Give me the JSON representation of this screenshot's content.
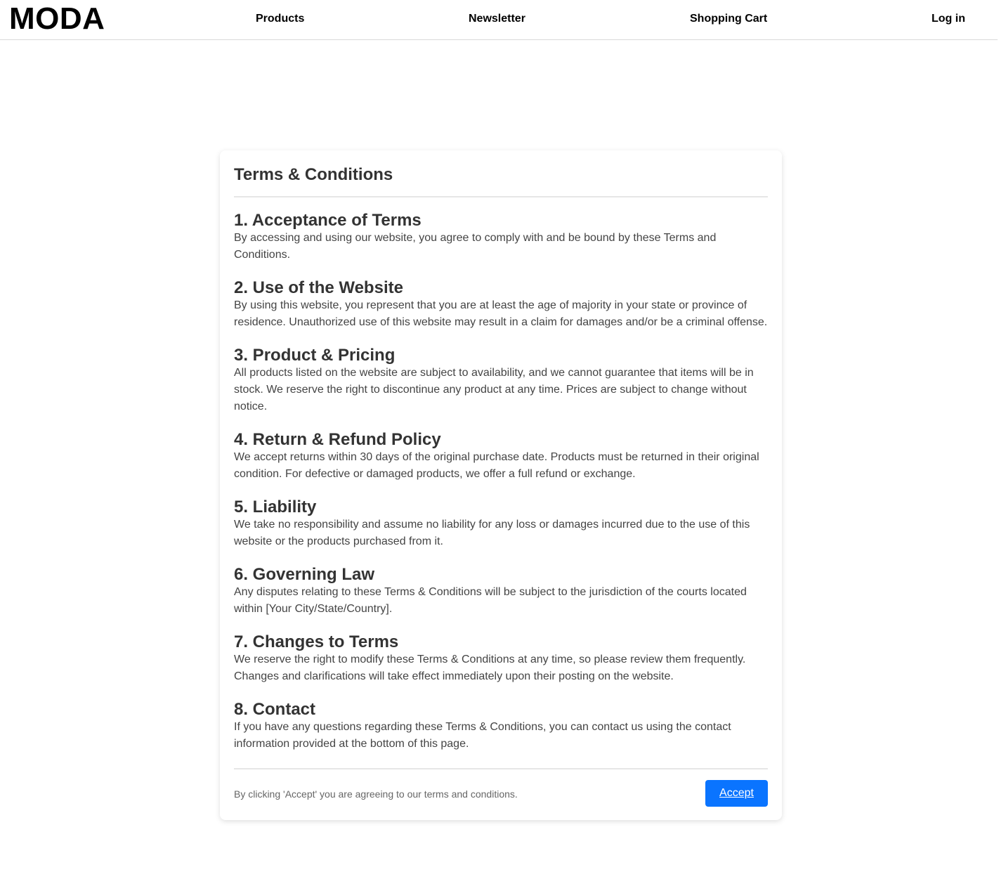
{
  "header": {
    "logo": "MODA",
    "nav": {
      "products": "Products",
      "newsletter": "Newsletter",
      "cart": "Shopping Cart",
      "login": "Log in"
    }
  },
  "terms": {
    "title": "Terms & Conditions",
    "sections": [
      {
        "heading": "1. Acceptance of Terms",
        "body": "By accessing and using our website, you agree to comply with and be bound by these Terms and Conditions."
      },
      {
        "heading": "2. Use of the Website",
        "body": "By using this website, you represent that you are at least the age of majority in your state or province of residence. Unauthorized use of this website may result in a claim for damages and/or be a criminal offense."
      },
      {
        "heading": "3. Product & Pricing",
        "body": "All products listed on the website are subject to availability, and we cannot guarantee that items will be in stock. We reserve the right to discontinue any product at any time. Prices are subject to change without notice."
      },
      {
        "heading": "4. Return & Refund Policy",
        "body": "We accept returns within 30 days of the original purchase date. Products must be returned in their original condition. For defective or damaged products, we offer a full refund or exchange."
      },
      {
        "heading": "5. Liability",
        "body": "We take no responsibility and assume no liability for any loss or damages incurred due to the use of this website or the products purchased from it."
      },
      {
        "heading": "6. Governing Law",
        "body": "Any disputes relating to these Terms & Conditions will be subject to the jurisdiction of the courts located within [Your City/State/Country]."
      },
      {
        "heading": "7. Changes to Terms",
        "body": "We reserve the right to modify these Terms & Conditions at any time, so please review them frequently. Changes and clarifications will take effect immediately upon their posting on the website."
      },
      {
        "heading": "8. Contact",
        "body": "If you have any questions regarding these Terms & Conditions, you can contact us using the contact information provided at the bottom of this page."
      }
    ],
    "footer_note": "By clicking 'Accept' you are agreeing to our terms and conditions.",
    "accept_label": "Accept"
  },
  "colors": {
    "accent": "#0a74ff"
  }
}
